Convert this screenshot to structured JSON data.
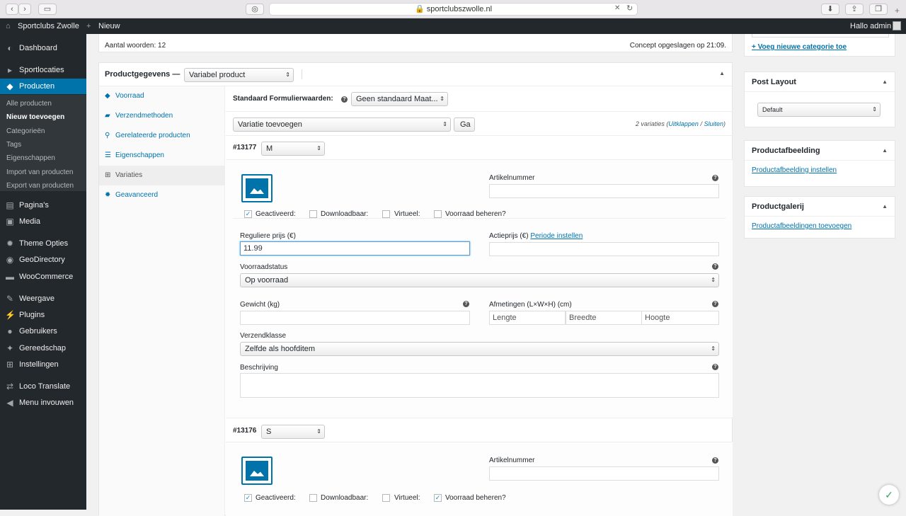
{
  "browser": {
    "url": "sportclubszwolle.nl"
  },
  "adminbar": {
    "site": "Sportclubs Zwolle",
    "new": "Nieuw",
    "greeting": "Hallo admin"
  },
  "sidebar": {
    "items": [
      {
        "label": "Dashboard",
        "icon": "dashboard-icon"
      },
      {
        "label": "Sportlocaties",
        "icon": "pin-icon"
      },
      {
        "label": "Producten",
        "icon": "box-icon"
      },
      {
        "label": "Pagina's",
        "icon": "page-icon"
      },
      {
        "label": "Media",
        "icon": "media-icon"
      },
      {
        "label": "Theme Opties",
        "icon": "gear-icon"
      },
      {
        "label": "GeoDirectory",
        "icon": "globe-icon"
      },
      {
        "label": "WooCommerce",
        "icon": "woo-icon"
      },
      {
        "label": "Weergave",
        "icon": "brush-icon"
      },
      {
        "label": "Plugins",
        "icon": "plug-icon"
      },
      {
        "label": "Gebruikers",
        "icon": "user-icon"
      },
      {
        "label": "Gereedschap",
        "icon": "wrench-icon"
      },
      {
        "label": "Instellingen",
        "icon": "settings-icon"
      },
      {
        "label": "Loco Translate",
        "icon": "translate-icon"
      },
      {
        "label": "Menu invouwen",
        "icon": "collapse-icon"
      }
    ],
    "submenu": [
      "Alle producten",
      "Nieuw toevoegen",
      "Categorieën",
      "Tags",
      "Eigenschappen",
      "Import van producten",
      "Export van producten"
    ]
  },
  "editor_footer": {
    "word_count": "Aantal woorden: 12",
    "saved": "Concept opgeslagen op 21:09."
  },
  "product": {
    "title": "Productgegevens —",
    "type": "Variabel product",
    "tabs": [
      {
        "label": "Voorraad",
        "icon": "diamond-icon"
      },
      {
        "label": "Verzendmethoden",
        "icon": "truck-icon"
      },
      {
        "label": "Gerelateerde producten",
        "icon": "link-icon"
      },
      {
        "label": "Eigenschappen",
        "icon": "list-icon"
      },
      {
        "label": "Variaties",
        "icon": "grid-icon"
      },
      {
        "label": "Geavanceerd",
        "icon": "gear-icon"
      }
    ],
    "default_form_label": "Standaard Formulierwaarden:",
    "default_form_value": "Geen standaard Maat...",
    "add_variation": "Variatie toevoegen",
    "go": "Ga",
    "variation_count": "2 variaties",
    "expand": "Uitklappen",
    "collapse": "Sluiten",
    "slash": "/"
  },
  "variation1": {
    "id": "#13177",
    "size": "M",
    "sku_label": "Artikelnummer",
    "enabled": "Geactiveerd:",
    "downloadable": "Downloadbaar:",
    "virtual": "Virtueel:",
    "manage_stock": "Voorraad beheren?",
    "regular_price_label": "Reguliere prijs (€)",
    "regular_price": "11.99",
    "sale_price_label": "Actieprijs (€)",
    "schedule": "Periode instellen",
    "stock_status_label": "Voorraadstatus",
    "stock_status": "Op voorraad",
    "weight_label": "Gewicht (kg)",
    "dimensions_label": "Afmetingen (L×W×H) (cm)",
    "length": "Lengte",
    "width": "Breedte",
    "height": "Hoogte",
    "shipping_label": "Verzendklasse",
    "shipping": "Zelfde als hoofditem",
    "description_label": "Beschrijving"
  },
  "variation2": {
    "id": "#13176",
    "size": "S",
    "sku_label": "Artikelnummer",
    "enabled": "Geactiveerd:",
    "downloadable": "Downloadbaar:",
    "virtual": "Virtueel:",
    "manage_stock": "Voorraad beheren?"
  },
  "right": {
    "add_category": "+ Voeg nieuwe categorie toe",
    "post_layout": "Post Layout",
    "layout_value": "Default",
    "product_image": "Productafbeelding",
    "set_image": "Productafbeelding instellen",
    "gallery": "Productgalerij",
    "add_gallery": "Productafbeeldingen toevoegen"
  }
}
